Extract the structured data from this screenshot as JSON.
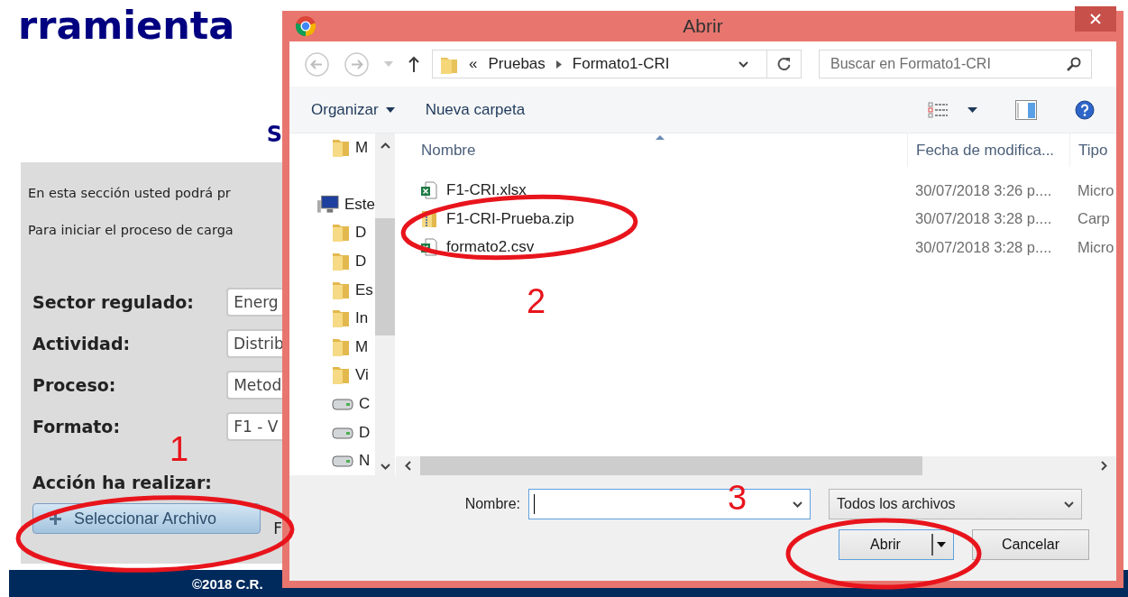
{
  "page": {
    "title": "rramienta",
    "subtitle": "S",
    "intro": [
      "En esta sección usted podrá pr",
      "Para iniciar el proceso de carga"
    ],
    "fields": [
      {
        "label": "Sector regulado:",
        "value": "Energ"
      },
      {
        "label": "Actividad:",
        "value": "Distrib"
      },
      {
        "label": "Proceso:",
        "value": "Metod"
      },
      {
        "label": "Formato:",
        "value": "F1 - V"
      }
    ],
    "action_label": "Acción ha realizar:",
    "select_button": "Seleccionar Archivo",
    "beside_text": "F",
    "footer": "©2018 C.R."
  },
  "dialog": {
    "title": "Abrir",
    "breadcrumb": {
      "overflow": "«",
      "items": [
        "Pruebas",
        "Formato1-CRI"
      ]
    },
    "search": {
      "placeholder": "Buscar en Formato1-CRI"
    },
    "toolbar": [
      {
        "label": "Organizar",
        "menu": true
      },
      {
        "label": "Nueva carpeta",
        "menu": false
      }
    ],
    "nav": [
      {
        "label": "M",
        "kind": "folder"
      },
      {
        "label": "Este",
        "kind": "computer",
        "children": [
          {
            "label": "D",
            "kind": "folder"
          },
          {
            "label": "D",
            "kind": "folder"
          },
          {
            "label": "Es",
            "kind": "folder"
          },
          {
            "label": "In",
            "kind": "folder"
          },
          {
            "label": "M",
            "kind": "folder"
          },
          {
            "label": "Vi",
            "kind": "folder"
          },
          {
            "label": "C",
            "kind": "drive"
          },
          {
            "label": "D",
            "kind": "drive"
          },
          {
            "label": "N",
            "kind": "drive"
          }
        ]
      }
    ],
    "columns": [
      "Nombre",
      "Fecha de modifica...",
      "Tipo"
    ],
    "files": [
      {
        "name": "F1-CRI.xlsx",
        "kind": "spreadsheet",
        "modified": "30/07/2018 3:26 p....",
        "type": "Micro"
      },
      {
        "name": "F1-CRI-Prueba.zip",
        "kind": "archive",
        "modified": "30/07/2018 3:28 p....",
        "type": "Carp"
      },
      {
        "name": "formato2.csv",
        "kind": "spreadsheet",
        "modified": "30/07/2018 3:28 p....",
        "type": "Micro"
      }
    ],
    "filename_label": "Nombre:",
    "filter": "Todos los archivos",
    "buttons": [
      "Abrir",
      "Cancelar"
    ]
  },
  "annotations": [
    "1",
    "2",
    "3"
  ]
}
